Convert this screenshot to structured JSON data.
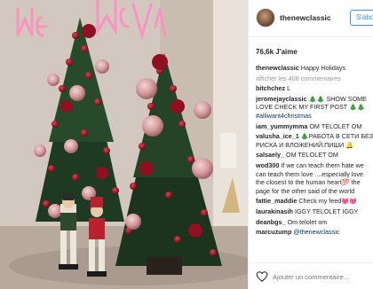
{
  "photo": {
    "neon_text": "Merry Xmas",
    "colors": {
      "wall": "#cfc4bb",
      "neon": "#ff7bb0",
      "tree": "#1f3a22",
      "berry": "#9c1224",
      "ornament": "#d9a3a6"
    }
  },
  "header": {
    "username": "thenewclassic",
    "follow_label": "S'abo"
  },
  "likes": "76,6k J'aime",
  "caption": {
    "user": "thenewclassic",
    "text": "Happy Holidays"
  },
  "view_all": "afficher les 408 commentaires",
  "comments": [
    {
      "user": "bitchchez",
      "text": "L"
    },
    {
      "user": "jeromejayclassic",
      "text": "🎄🎄 SHOW SOME LOVE CHECK MY FIRST POST 🎄🎄",
      "tag": "#alliwant4christmas"
    },
    {
      "user": "iam_yummymma",
      "text": "ОМ TELOLET OM"
    },
    {
      "user": "valusha_ice_1",
      "text": "🎄РАБОТА В СЕТИ БЕЗ РИСКА И ВЛОЖЕНИЙ.ПИШИ 🔔"
    },
    {
      "user": "salsaely_",
      "text": "OM TELOLET OM"
    },
    {
      "user": "wod300",
      "text": "If we can teach them hate we can teach them love ....especially love the closest to the human heart💯 the page for the other said of the world"
    },
    {
      "user": "fattie_maddie",
      "text": "Check my feed💓💓"
    },
    {
      "user": "laurakinasih",
      "text": "IGGY TELOLET IGGY"
    },
    {
      "user": "deanbgs_",
      "text": "Om telolet om"
    },
    {
      "user": "marcuzump",
      "text": "",
      "tag": "@thenewclassic"
    }
  ],
  "add_comment_placeholder": "Ajouter un commentaire…",
  "accent_color": "#3897f0"
}
